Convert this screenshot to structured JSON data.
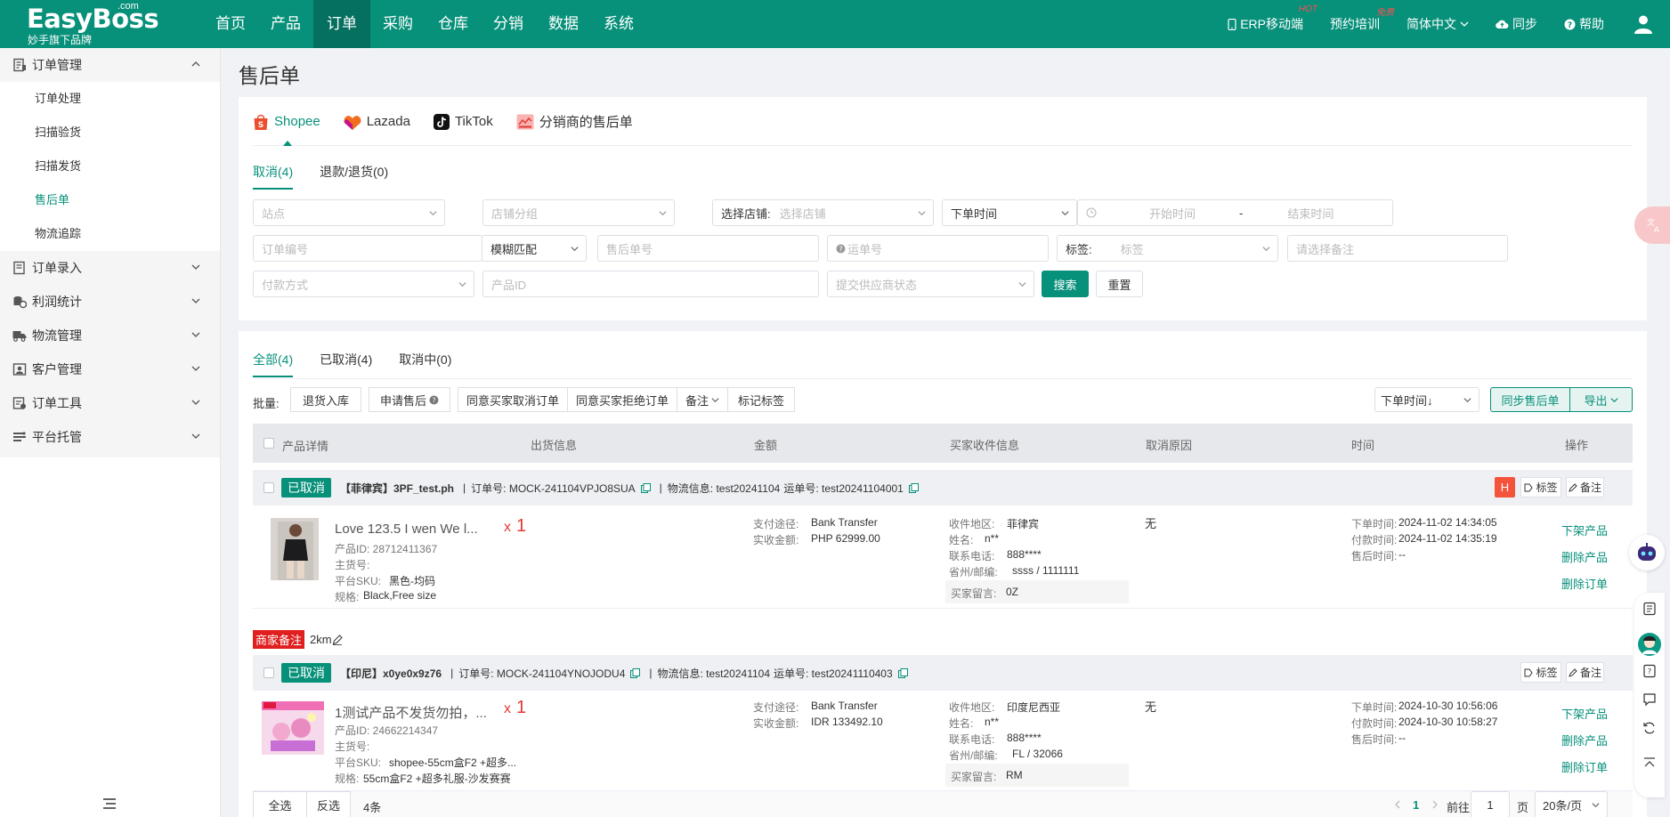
{
  "brand": {
    "name": "EasyBoss",
    "com": ".com",
    "sub": "妙手旗下品牌"
  },
  "nav": [
    "首页",
    "产品",
    "订单",
    "采购",
    "仓库",
    "分销",
    "数据",
    "系统"
  ],
  "nav_active_index": 2,
  "topright": {
    "erp": "ERP移动端",
    "erp_sup": "HOT",
    "training": "预约培训",
    "training_sup": "免费",
    "lang": "简体中文",
    "sync": "同步",
    "help": "帮助"
  },
  "sidebar": {
    "groups": [
      {
        "label": "订单管理",
        "open": true,
        "items": [
          "订单处理",
          "扫描验货",
          "扫描发货",
          "售后单",
          "物流追踪"
        ],
        "active_item": 3
      },
      {
        "label": "订单录入"
      },
      {
        "label": "利润统计"
      },
      {
        "label": "物流管理"
      },
      {
        "label": "客户管理"
      },
      {
        "label": "订单工具"
      },
      {
        "label": "平台托管"
      }
    ]
  },
  "page": {
    "title": "售后单"
  },
  "platform_tabs": [
    "Shopee",
    "Lazada",
    "TikTok",
    "分销商的售后单"
  ],
  "status_tabs": [
    "取消(4)",
    "退款/退货(0)"
  ],
  "filters": {
    "site": "站点",
    "shop_group": "店铺分组",
    "shop_label": "选择店铺:",
    "shop_placeholder": "选择店铺",
    "time_type": "下单时间",
    "start_time": "开始时间",
    "dash": "-",
    "end_time": "结束时间",
    "order_no": "订单编号",
    "match": "模糊匹配",
    "after_sale_no": "售后单号",
    "waybill_no": "运单号",
    "tag_label": "标签:",
    "tag_placeholder": "标签",
    "remark": "请选择备注",
    "payment": "付款方式",
    "product_id": "产品ID",
    "supplier_status": "提交供应商状态",
    "search": "搜索",
    "reset": "重置"
  },
  "order_tabs": [
    "全部(4)",
    "已取消(4)",
    "取消中(0)"
  ],
  "bulk": {
    "label": "批量:",
    "return_stock": "退货入库",
    "apply_after_sale": "申请售后",
    "agree_cancel": "同意买家取消订单",
    "reject_cancel": "同意买家拒绝订单",
    "remark": "备注",
    "mark_tag": "标记标签",
    "sort": "下单时间↓",
    "sync": "同步售后单",
    "export": "导出"
  },
  "table_headers": [
    "产品详情",
    "出货信息",
    "金额",
    "买家收件信息",
    "取消原因",
    "时间",
    "操作"
  ],
  "orders": [
    {
      "status": "已取消",
      "shop": "【菲律宾】3PF_test.ph",
      "order_no": "订单号: MOCK-241104VPJO8SUA",
      "logistics": "物流信息: test20241104",
      "waybill": "运单号: test20241104001",
      "h_badge": "H",
      "tag_btn": "标签",
      "remark_btn": "备注",
      "product_title": "Love 123.5 I wen We l...",
      "product_id": "产品ID: 28712411367",
      "main_sku": "主货号:",
      "platform_sku_label": "平台SKU:",
      "platform_sku": "黑色-均码",
      "spec_label": "规格:",
      "spec": "Black,Free size",
      "qty_x": "x",
      "qty": "1",
      "pay_label": "支付途径:",
      "pay": "Bank Transfer",
      "amount_label": "实收金额:",
      "amount": "PHP 62999.00",
      "region_label": "收件地区:",
      "region": "菲律宾",
      "name_label": "姓名:",
      "name": "n**",
      "phone_label": "联系电话:",
      "phone": "888****",
      "zip_label": "省州/邮编:",
      "zip": "ssss / 1111111",
      "msg_label": "买家留言:",
      "msg": "0Z",
      "reason": "无",
      "order_time_label": "下单时间:",
      "order_time": "2024-11-02 14:34:05",
      "pay_time_label": "付款时间:",
      "pay_time": "2024-11-02 14:35:19",
      "after_time_label": "售后时间:",
      "after_time": "--",
      "ops": [
        "下架产品",
        "删除产品",
        "删除订单"
      ]
    },
    {
      "status": "已取消",
      "shop": "【印尼】x0ye0x9z76",
      "order_no": "订单号: MOCK-241104YNOJODU4",
      "logistics": "物流信息: test20241104",
      "waybill": "运单号: test20241110403",
      "tag_btn": "标签",
      "remark_btn": "备注",
      "product_title": "1测试产品不发货勿拍，...",
      "product_id": "产品ID: 24662214347",
      "main_sku": "主货号:",
      "platform_sku_label": "平台SKU:",
      "platform_sku": "shopee-55cm盒F2 +超多...",
      "spec_label": "规格:",
      "spec": "55cm盒F2 +超多礼服-沙发赛赛",
      "qty_x": "x",
      "qty": "1",
      "pay_label": "支付途径:",
      "pay": "Bank Transfer",
      "amount_label": "实收金额:",
      "amount": "IDR 133492.10",
      "region_label": "收件地区:",
      "region": "印度尼西亚",
      "name_label": "姓名:",
      "name": "n**",
      "phone_label": "联系电话:",
      "phone": "888****",
      "zip_label": "省州/邮编:",
      "zip": "FL / 32066",
      "msg_label": "买家留言:",
      "msg": "RM",
      "reason": "无",
      "order_time_label": "下单时间:",
      "order_time": "2024-10-30 10:56:06",
      "pay_time_label": "付款时间:",
      "pay_time": "2024-10-30 10:58:27",
      "after_time_label": "售后时间:",
      "after_time": "--",
      "ops": [
        "下架产品",
        "删除产品",
        "删除订单"
      ]
    }
  ],
  "merchant_note": {
    "tag": "商家备注",
    "text": "2km"
  },
  "footer": {
    "select_all": "全选",
    "invert": "反选",
    "count": "4条",
    "page": "1",
    "goto_label": "前往",
    "goto_value": "1",
    "page_unit": "页",
    "page_size": "20条/页"
  },
  "colors": {
    "brand": "#07907a",
    "brand_dark": "#05705f",
    "danger": "#e02020"
  }
}
